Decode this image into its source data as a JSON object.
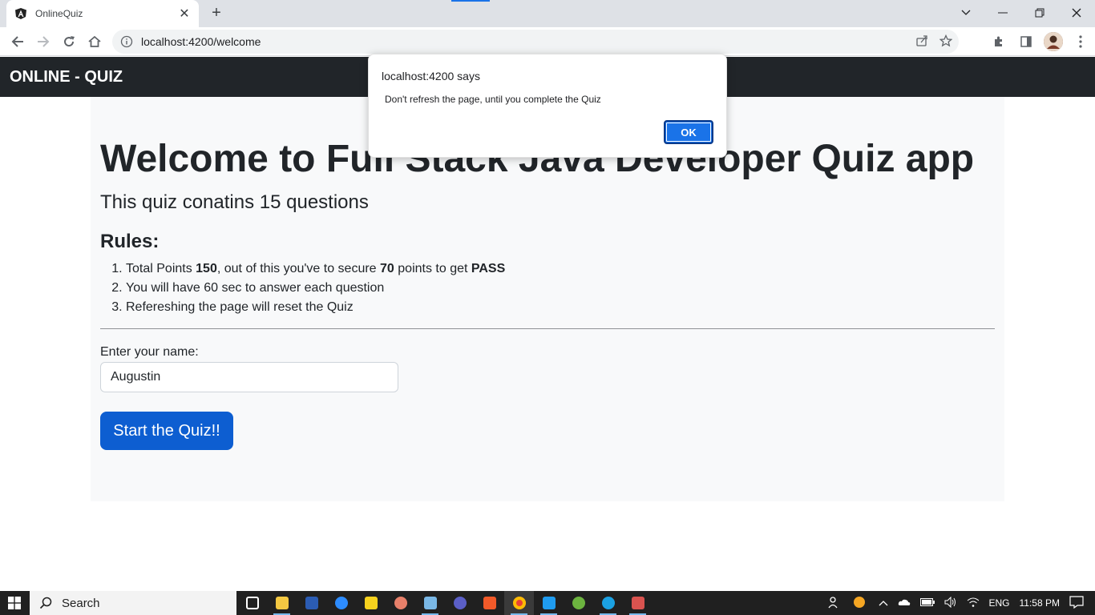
{
  "browser": {
    "tab_title": "OnlineQuiz",
    "tab_close": "✕",
    "new_tab": "+",
    "url": "localhost:4200/welcome"
  },
  "app": {
    "brand": "ONLINE - QUIZ",
    "heading": "Welcome to Full Stack Java Developer Quiz app",
    "lead": "This quiz conatins 15 questions",
    "rules_title": "Rules:",
    "rules": {
      "r1_a": "Total Points ",
      "r1_b": "150",
      "r1_c": ", out of this you've to secure ",
      "r1_d": "70",
      "r1_e": " points to get ",
      "r1_f": "PASS",
      "r2": "You will have 60 sec to answer each question",
      "r3": "Refereshing the page will reset the Quiz"
    },
    "name_label": "Enter your name:",
    "name_value": "Augustin",
    "start_button": "Start the Quiz!!"
  },
  "dialog": {
    "title": "localhost:4200 says",
    "message": "Don't refresh the page, until you complete the Quiz",
    "ok": "OK"
  },
  "taskbar": {
    "search_label": "Search",
    "lang": "ENG",
    "time": "11:58 PM"
  },
  "colors": {
    "navbar": "#212529",
    "primary_button": "#0d5ed1",
    "dialog_ok": "#1a73e8"
  }
}
